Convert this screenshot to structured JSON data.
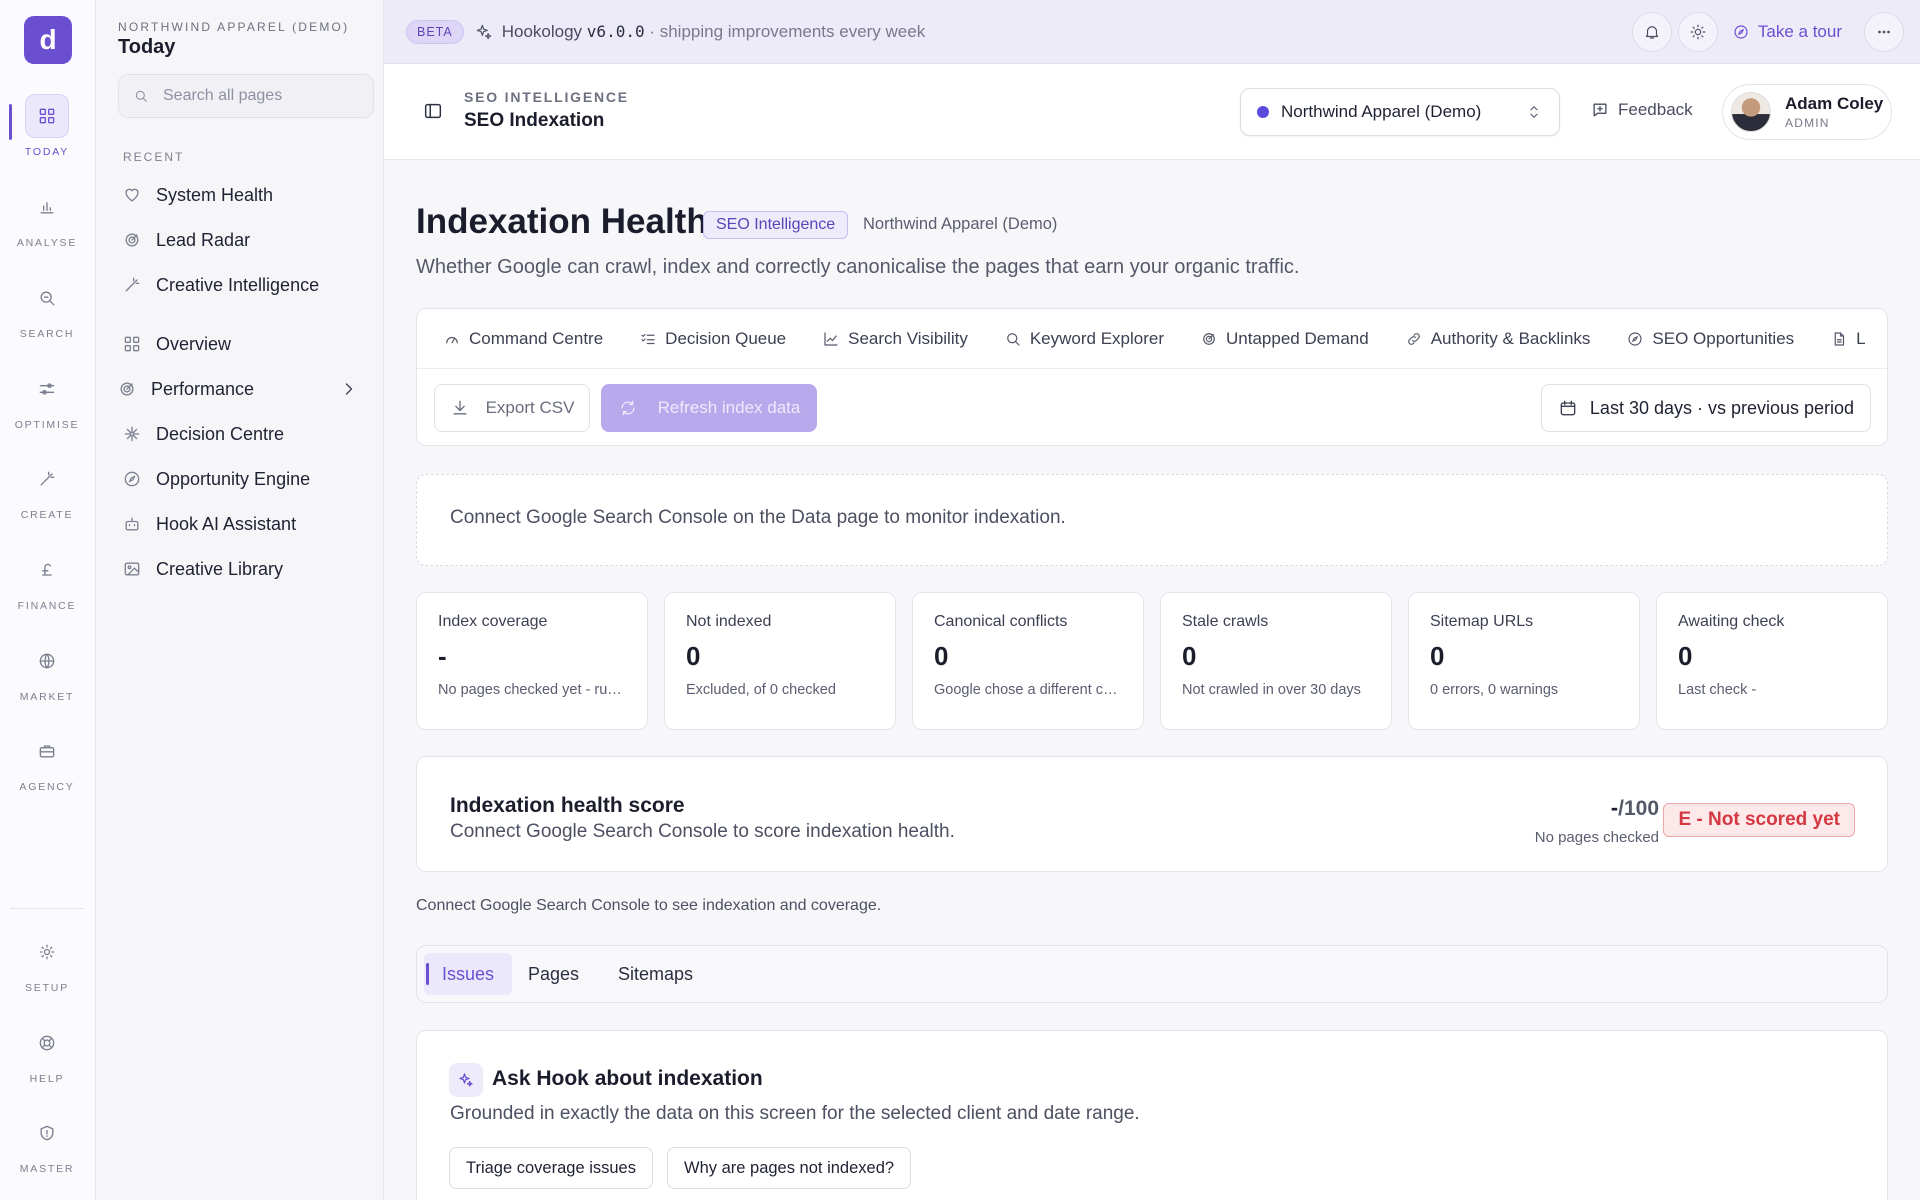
{
  "rail": {
    "logo": "d",
    "items": [
      {
        "label": "TODAY",
        "icon": "dashboard-icon"
      },
      {
        "label": "ANALYSE",
        "icon": "bar-chart-icon"
      },
      {
        "label": "SEARCH",
        "icon": "search-icon"
      },
      {
        "label": "OPTIMISE",
        "icon": "sliders-icon"
      },
      {
        "label": "CREATE",
        "icon": "magic-wand-icon"
      },
      {
        "label": "FINANCE",
        "icon": "pound-icon"
      },
      {
        "label": "MARKET",
        "icon": "globe-icon"
      },
      {
        "label": "AGENCY",
        "icon": "briefcase-icon"
      },
      {
        "label": "SETUP",
        "icon": "gear-icon"
      },
      {
        "label": "HELP",
        "icon": "lifebuoy-icon"
      },
      {
        "label": "MASTER",
        "icon": "shield-icon"
      }
    ]
  },
  "sidebar": {
    "org": "NORTHWIND APPAREL (DEMO)",
    "title": "Today",
    "search_placeholder": "Search all pages",
    "recent_label": "RECENT",
    "recent": [
      {
        "label": "System Health",
        "icon": "heart-icon"
      },
      {
        "label": "Lead Radar",
        "icon": "radar-icon"
      },
      {
        "label": "Creative Intelligence",
        "icon": "magic-wand-icon"
      }
    ],
    "items": [
      {
        "label": "Overview",
        "icon": "dashboard-icon"
      },
      {
        "label": "Performance",
        "icon": "radar-icon"
      },
      {
        "label": "Decision Centre",
        "icon": "network-icon"
      },
      {
        "label": "Opportunity Engine",
        "icon": "compass-icon"
      },
      {
        "label": "Hook AI Assistant",
        "icon": "robot-icon"
      },
      {
        "label": "Creative Library",
        "icon": "image-icon"
      }
    ]
  },
  "banner": {
    "badge": "BETA",
    "app": "Hookology",
    "version": "v6.0.0",
    "tagline": "· shipping improvements every week",
    "tour": "Take a tour"
  },
  "header": {
    "section": "SEO INTELLIGENCE",
    "title": "SEO Indexation",
    "client": "Northwind Apparel (Demo)",
    "feedback": "Feedback",
    "user_name": "Adam Coley",
    "user_role": "ADMIN"
  },
  "page": {
    "title": "Indexation Health",
    "tag": "SEO Intelligence",
    "client": "Northwind Apparel (Demo)",
    "description": "Whether Google can crawl, index and correctly canonicalise the pages that earn your organic traffic."
  },
  "tabs": [
    {
      "label": "Command Centre",
      "icon": "gauge-icon"
    },
    {
      "label": "Decision Queue",
      "icon": "checklist-icon"
    },
    {
      "label": "Search Visibility",
      "icon": "line-chart-icon"
    },
    {
      "label": "Keyword Explorer",
      "icon": "search-icon"
    },
    {
      "label": "Untapped Demand",
      "icon": "radar-icon"
    },
    {
      "label": "Authority & Backlinks",
      "icon": "link-icon"
    },
    {
      "label": "SEO Opportunities",
      "icon": "compass-icon"
    },
    {
      "label": "L",
      "icon": "document-icon"
    }
  ],
  "toolbar": {
    "export": "Export CSV",
    "refresh": "Refresh index data",
    "date_range": "Last 30 days · vs previous period"
  },
  "notice": "Connect Google Search Console on the Data page to monitor indexation.",
  "kpis": [
    {
      "label": "Index coverage",
      "value": "-",
      "sub": "No pages checked yet - run a check"
    },
    {
      "label": "Not indexed",
      "value": "0",
      "sub": "Excluded, of 0 checked"
    },
    {
      "label": "Canonical conflicts",
      "value": "0",
      "sub": "Google chose a different canonical"
    },
    {
      "label": "Stale crawls",
      "value": "0",
      "sub": "Not crawled in over 30 days"
    },
    {
      "label": "Sitemap URLs",
      "value": "0",
      "sub": "0 errors, 0 warnings"
    },
    {
      "label": "Awaiting check",
      "value": "0",
      "sub": "Last check -"
    }
  ],
  "score": {
    "title": "Indexation health score",
    "description": "Connect Google Search Console to score indexation health.",
    "value": "-",
    "denominator": "/100",
    "meta": "No pages checked",
    "grade": "E - Not scored yet",
    "grade_color": "#d43842"
  },
  "gsc_note": "Connect Google Search Console to see indexation and coverage.",
  "subtabs": [
    "Issues",
    "Pages",
    "Sitemaps"
  ],
  "ask": {
    "title": "Ask Hook about indexation",
    "description": "Grounded in exactly the data on this screen for the selected client and date range.",
    "chips": [
      "Triage coverage issues",
      "Why are pages not indexed?"
    ]
  },
  "colors": {
    "accent": "#6b4fd1",
    "banner_bg": "#eeebf9"
  }
}
